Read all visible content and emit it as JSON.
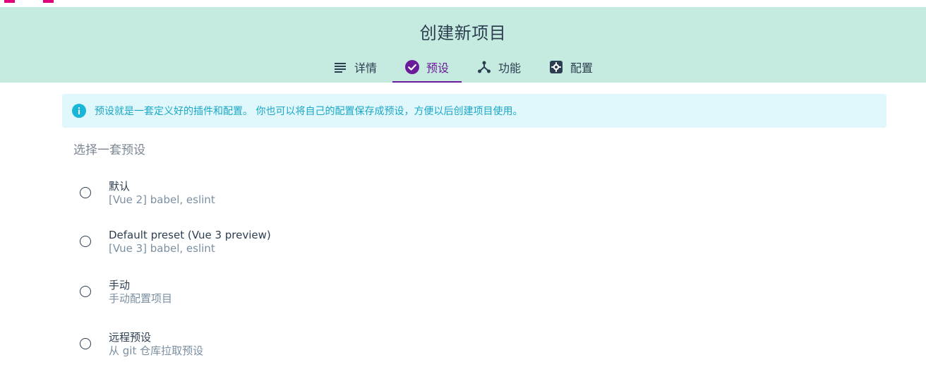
{
  "header": {
    "title": "创建新项目",
    "tabs": [
      {
        "label": "详情",
        "icon": "list-icon",
        "active": false
      },
      {
        "label": "预设",
        "icon": "check-circle-icon",
        "active": true
      },
      {
        "label": "功能",
        "icon": "merge-icon",
        "active": false
      },
      {
        "label": "配置",
        "icon": "settings-icon",
        "active": false
      }
    ]
  },
  "info": {
    "text": "预设就是一套定义好的插件和配置。 你也可以将自己的配置保存成预设，方便以后创建项目使用。",
    "icon": "info-icon"
  },
  "section": {
    "title": "选择一套预设"
  },
  "presets": [
    {
      "name": "默认",
      "description": "[Vue 2] babel, eslint"
    },
    {
      "name": "Default preset (Vue 3 preview)",
      "description": "[Vue 3] babel, eslint"
    },
    {
      "name": "手动",
      "description": "手动配置项目"
    },
    {
      "name": "远程预设",
      "description": "从 git 仓库拉取预设"
    }
  ],
  "colors": {
    "header_bg": "#c5eadf",
    "accent": "#6a1b9a",
    "info_bg": "#e0f8fc",
    "info_text": "#1aa7c7",
    "top_mark": "#e0007a"
  }
}
